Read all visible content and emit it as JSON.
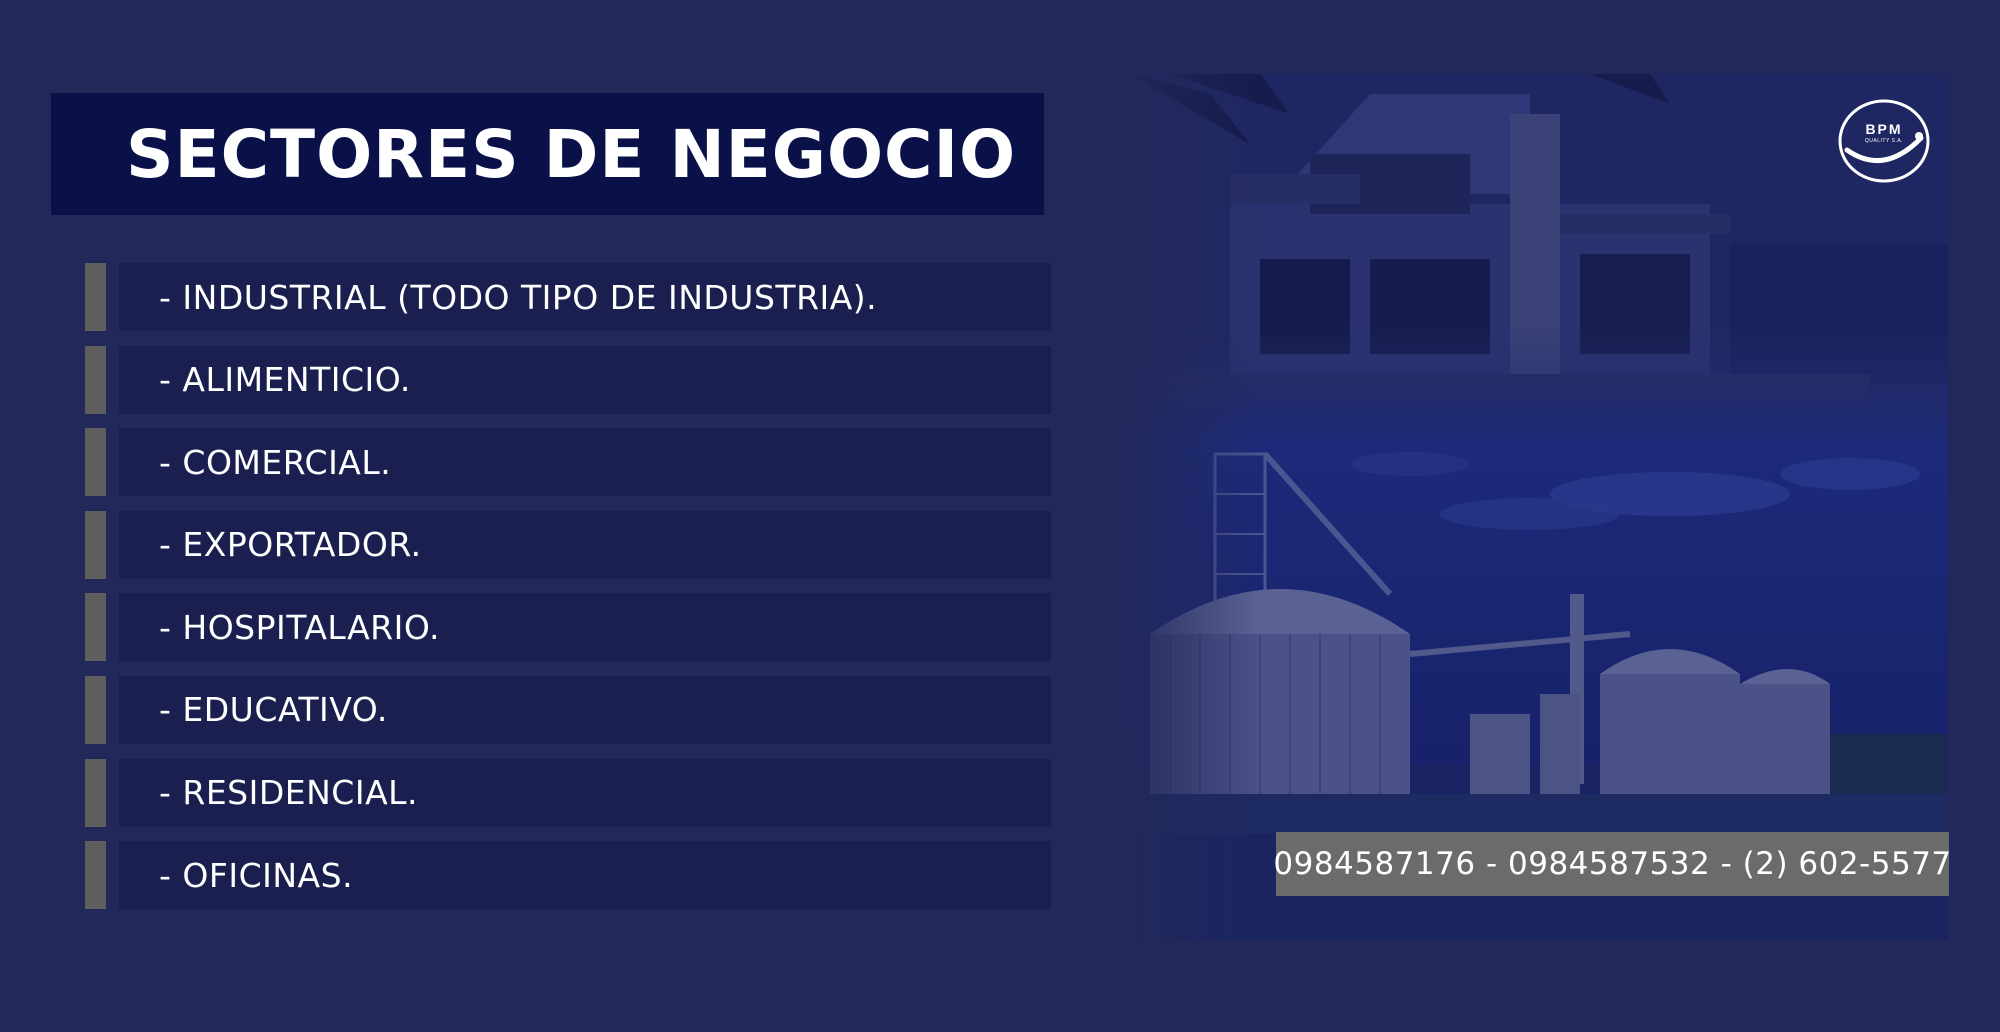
{
  "header": {
    "title": "SECTORES DE NEGOCIO"
  },
  "sectors": [
    {
      "label": "- INDUSTRIAL (TODO TIPO DE INDUSTRIA)."
    },
    {
      "label": "- ALIMENTICIO."
    },
    {
      "label": "- COMERCIAL."
    },
    {
      "label": "- EXPORTADOR."
    },
    {
      "label": "- HOSPITALARIO."
    },
    {
      "label": "- EDUCATIVO."
    },
    {
      "label": "- RESIDENCIAL."
    },
    {
      "label": "- OFICINAS."
    }
  ],
  "contact": {
    "phones": "0984587176 - 0984587532 - (2) 602-5577"
  },
  "logo": {
    "text": "BPM",
    "subtext": "QUALITY S.A."
  },
  "colors": {
    "background": "#22295a",
    "title_box": "#0a1148",
    "sector_bar": "#1b1f4f",
    "sector_marker": "#5e5e5e",
    "phone_box": "#6b6b6b"
  }
}
